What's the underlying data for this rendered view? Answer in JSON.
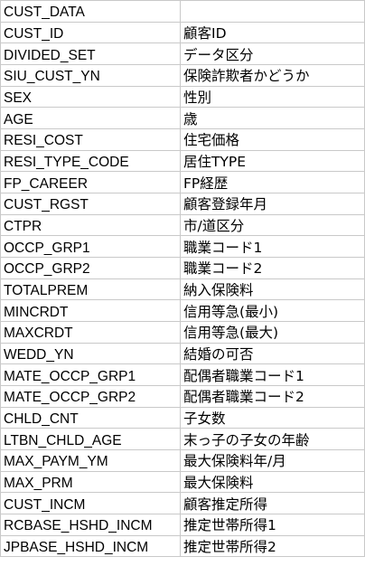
{
  "rows": [
    {
      "key": "CUST_DATA",
      "value": ""
    },
    {
      "key": "CUST_ID",
      "value": "顧客ID"
    },
    {
      "key": "DIVIDED_SET",
      "value": "データ区分"
    },
    {
      "key": "SIU_CUST_YN",
      "value": "保険詐欺者かどうか"
    },
    {
      "key": "SEX",
      "value": "性別"
    },
    {
      "key": "AGE",
      "value": "歳"
    },
    {
      "key": "RESI_COST",
      "value": "住宅価格"
    },
    {
      "key": "RESI_TYPE_CODE",
      "value": "居住TYPE"
    },
    {
      "key": "FP_CAREER",
      "value": "FP経歴"
    },
    {
      "key": "CUST_RGST",
      "value": "顧客登録年月"
    },
    {
      "key": "CTPR",
      "value": "市/道区分"
    },
    {
      "key": "OCCP_GRP1",
      "value": "職業コード1"
    },
    {
      "key": "OCCP_GRP2",
      "value": "職業コード2"
    },
    {
      "key": "TOTALPREM",
      "value": "納入保険料"
    },
    {
      "key": "MINCRDT",
      "value": "信用等急(最小)"
    },
    {
      "key": "MAXCRDT",
      "value": "信用等急(最大)"
    },
    {
      "key": "WEDD_YN",
      "value": "結婚の可否"
    },
    {
      "key": "MATE_OCCP_GRP1",
      "value": "配偶者職業コード1"
    },
    {
      "key": "MATE_OCCP_GRP2",
      "value": "配偶者職業コード2"
    },
    {
      "key": "CHLD_CNT",
      "value": "子女数"
    },
    {
      "key": "LTBN_CHLD_AGE",
      "value": "末っ子の子女の年齢"
    },
    {
      "key": "MAX_PAYM_YM",
      "value": "最大保険料年/月"
    },
    {
      "key": "MAX_PRM",
      "value": "最大保険料"
    },
    {
      "key": "CUST_INCM",
      "value": "顧客推定所得"
    },
    {
      "key": "RCBASE_HSHD_INCM",
      "value": "推定世帯所得1"
    },
    {
      "key": "JPBASE_HSHD_INCM",
      "value": "推定世帯所得2"
    }
  ]
}
